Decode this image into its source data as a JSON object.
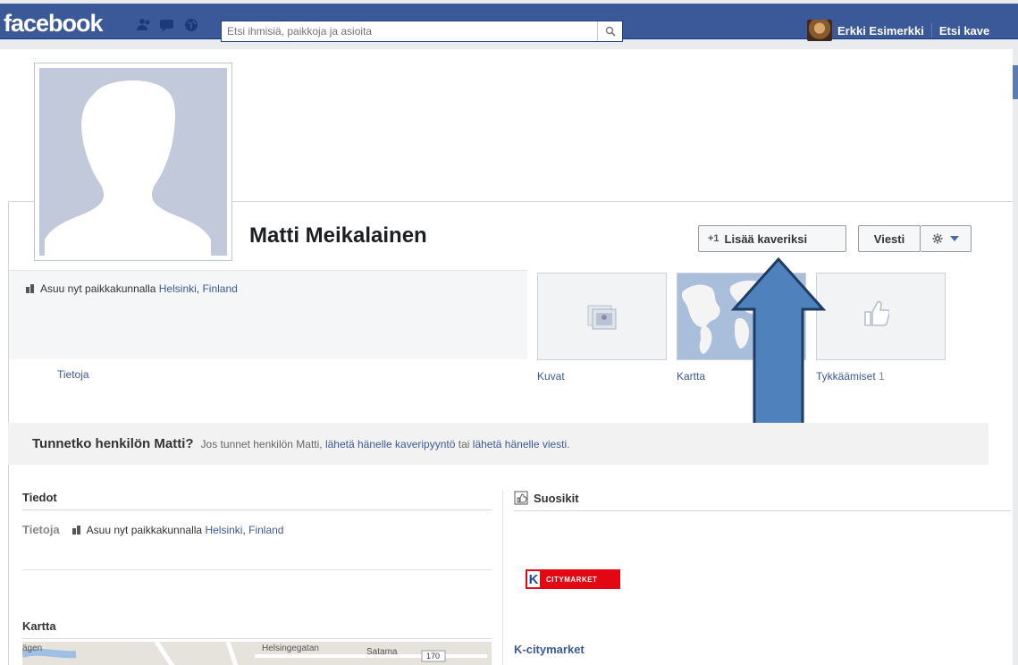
{
  "topbar": {
    "logo": "facebook",
    "search_placeholder": "Etsi ihmisiä, paikkoja ja asioita",
    "user_name": "Erkki Esimerkki",
    "find_friends": "Etsi kave"
  },
  "profile": {
    "name": "Matti Meikalainen",
    "add_friend_icon": "+1",
    "add_friend_label": "Lisää kaveriksi",
    "message_label": "Viesti",
    "lives_prefix": "Asuu nyt paikkakunnalla",
    "lives_city": "Helsinki",
    "lives_country": "Finland",
    "tab_about": "Tietoja"
  },
  "thumbs": [
    {
      "label": "Kuvat",
      "icon": "photos-icon"
    },
    {
      "label": "Kartta",
      "icon": "map-icon"
    },
    {
      "label": "Tykkäämiset",
      "count": "1",
      "icon": "like-icon"
    }
  ],
  "know": {
    "question": "Tunnetko henkilön Matti?",
    "pre": "Jos tunnet henkilön Matti,",
    "link1": "lähetä hänelle kaveripyyntö",
    "mid": "tai",
    "link2": "lähetä hänelle viesti",
    "end": "."
  },
  "info": {
    "heading": "Tiedot",
    "row_label": "Tietoja",
    "lives_prefix": "Asuu nyt paikkakunnalla",
    "city": "Helsinki",
    "country": "Finland",
    "map_heading": "Kartta",
    "map_labels": [
      "ägen",
      "Helsingegatan",
      "Satama",
      "170"
    ]
  },
  "favorites": {
    "heading": "Suosikit",
    "logo_letter": "K",
    "logo_text": "CITYMARKET",
    "item_name": "K-citymarket"
  },
  "colors": {
    "brand": "#3b5998",
    "annotation_arrow": "#4f81bd"
  }
}
